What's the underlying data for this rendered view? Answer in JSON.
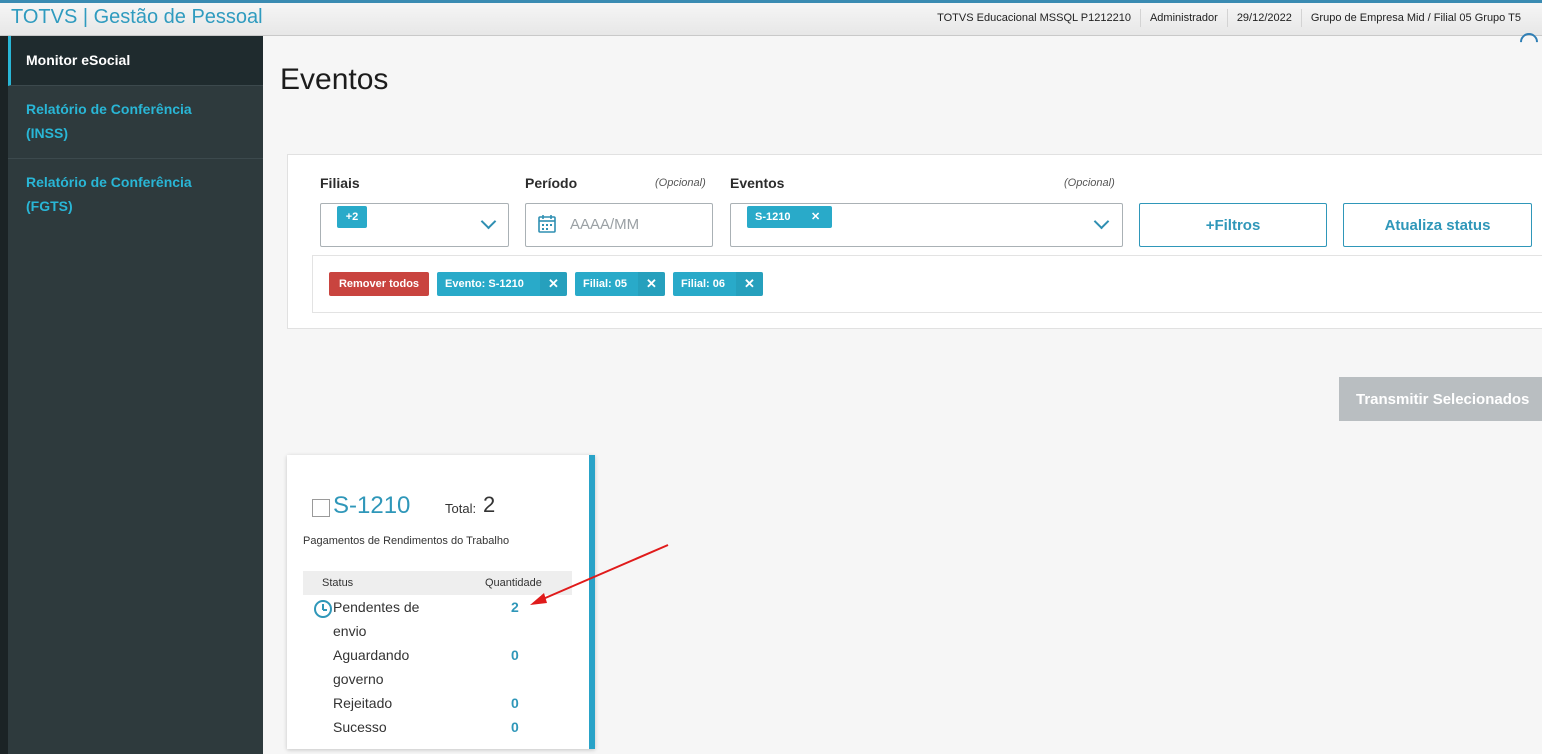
{
  "header": {
    "app_title": "TOTVS | Gestão de Pessoal",
    "environment": "TOTVS Educacional MSSQL P1212210",
    "user": "Administrador",
    "date": "29/12/2022",
    "company": "Grupo de Empresa Mid / Filial 05 Grupo T5"
  },
  "sidebar": {
    "items": [
      {
        "label": "Monitor eSocial",
        "active": true
      },
      {
        "label_line1": "Relatório de Conferência",
        "label_line2": "(INSS)"
      },
      {
        "label_line1": "Relatório de Conferência",
        "label_line2": "(FGTS)"
      }
    ]
  },
  "page": {
    "title": "Eventos"
  },
  "filters": {
    "filiais": {
      "label": "Filiais",
      "chip": "+2"
    },
    "periodo": {
      "label": "Período",
      "optional": "(Opcional)",
      "placeholder": "AAAA/MM"
    },
    "eventos": {
      "label": "Eventos",
      "optional": "(Opcional)",
      "chip": "S-1210",
      "chip_remove": "✕"
    },
    "more_filters_label": "+Filtros",
    "update_status_label": "Atualiza status"
  },
  "active_tags": {
    "remove_all": "Remover todos",
    "tags": [
      {
        "label": "Evento: S-1210",
        "remove": "✕"
      },
      {
        "label": "Filial: 05",
        "remove": "✕"
      },
      {
        "label": "Filial: 06",
        "remove": "✕"
      }
    ]
  },
  "transmit_label": "Transmitir Selecionados",
  "event_card": {
    "code": "S-1210",
    "total_label": "Total:",
    "total_value": "2",
    "description": "Pagamentos de Rendimentos do Trabalho",
    "status_header": "Status",
    "quantity_header": "Quantidade",
    "rows": [
      {
        "line1": "Pendentes de",
        "line2": "envio",
        "value": "2",
        "icon": "clock-icon"
      },
      {
        "line1": "Aguardando",
        "line2": "governo",
        "value": "0"
      },
      {
        "line1": "Rejeitado",
        "value": "0"
      },
      {
        "line1": "Sucesso",
        "value": "0"
      }
    ]
  },
  "colors": {
    "accent": "#29aac9",
    "brand_title": "#2f9bbf",
    "sidebar_bg": "#2e3a3d",
    "danger": "#c9443f",
    "disabled": "#b9bec1",
    "annotation_arrow": "#e01b1b"
  }
}
